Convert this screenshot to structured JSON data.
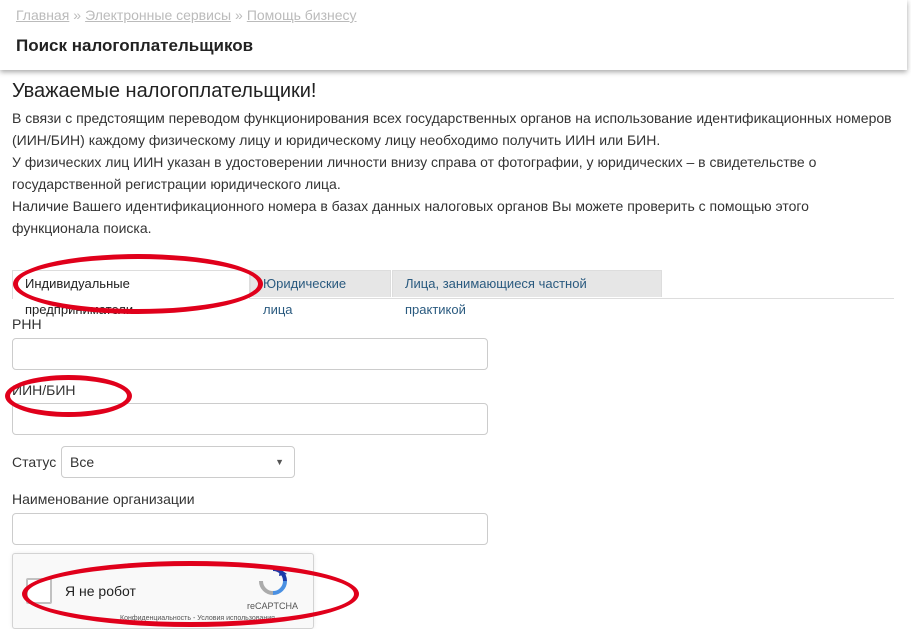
{
  "breadcrumb": {
    "items": [
      "Главная",
      "Электронные сервисы",
      "Помощь бизнесу"
    ],
    "separator": "»"
  },
  "header": {
    "title": "Поиск налогоплательщиков"
  },
  "intro": {
    "heading": "Уважаемые налогоплательщики!",
    "paragraphs": [
      "В связи с предстоящим переводом функционирования всех государственных органов на использование идентификационных номеров (ИИН/БИН) каждому физическому лицу и юридическому лицу необходимо получить ИИН или БИН.",
      "У физических лиц ИИН указан в удостоверении личности внизу справа от фотографии, у юридических – в свидетельстве о государственной регистрации юридического лица.",
      "Наличие Вашего идентификационного номера в базах данных налоговых органов Вы можете проверить с помощью этого функционала поиска."
    ]
  },
  "tabs": [
    {
      "label": "Индивидуальные предприниматели",
      "active": true
    },
    {
      "label": "Юридические лица",
      "active": false
    },
    {
      "label": "Лица, занимающиеся частной практикой",
      "active": false
    }
  ],
  "form": {
    "rnn_label": "РНН",
    "rnn_value": "",
    "iin_label": "ИИН/БИН",
    "iin_value": "",
    "status_label": "Статус",
    "status_value": "Все",
    "org_label": "Наименование организации",
    "org_value": ""
  },
  "captcha": {
    "label": "Я не робот",
    "brand": "reCAPTCHA",
    "terms": "Конфиденциальность - Условия использования"
  },
  "colors": {
    "annotation": "#e0001b",
    "link": "#2a5a7f",
    "muted": "#bbbbbb"
  },
  "icons": [
    "chevron-down-icon",
    "recaptcha-logo-icon"
  ]
}
